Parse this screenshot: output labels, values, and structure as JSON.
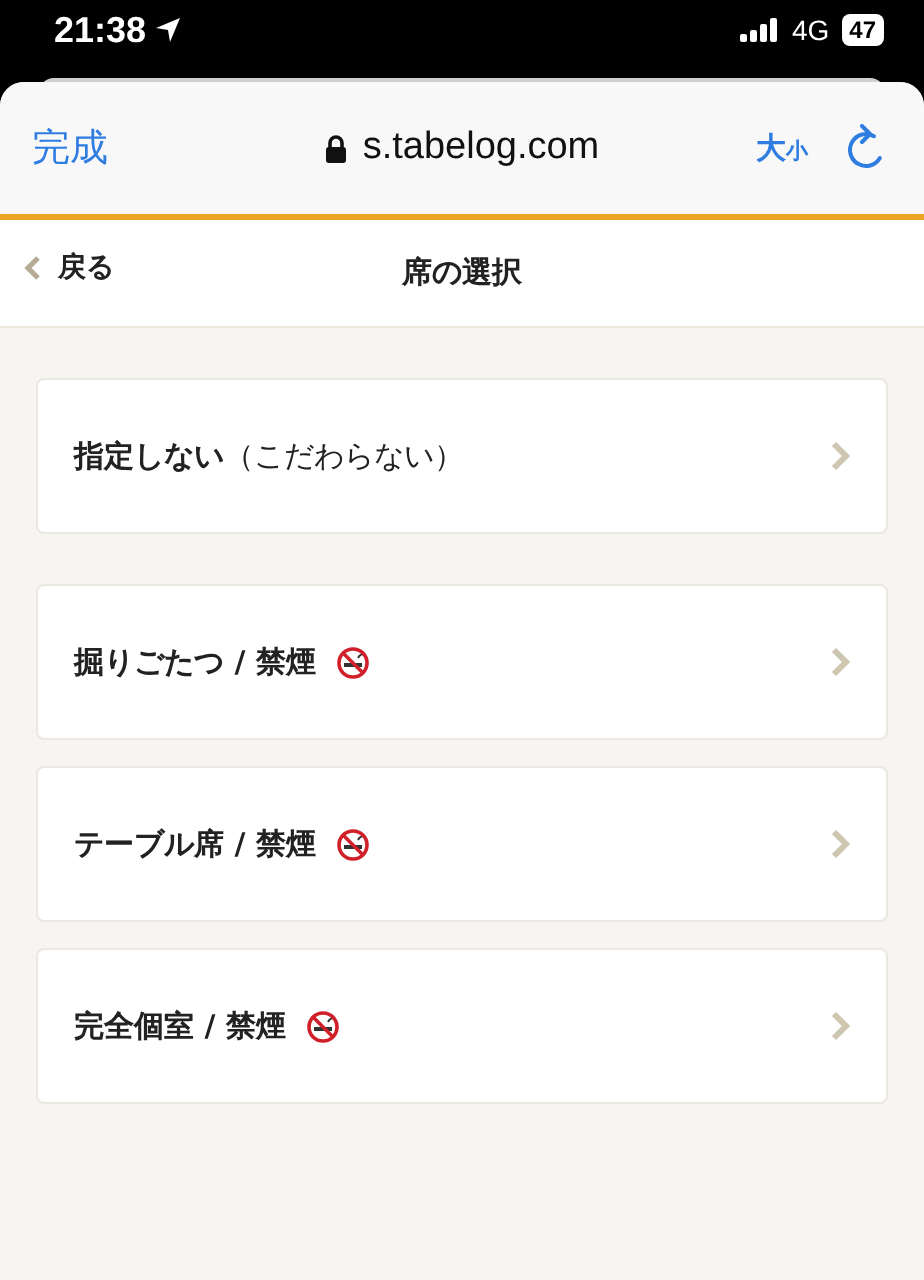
{
  "status_bar": {
    "time": "21:38",
    "network": "4G",
    "battery": "47"
  },
  "browser": {
    "done": "完成",
    "url": "s.tabelog.com",
    "text_size_big": "大",
    "text_size_small": "小"
  },
  "header": {
    "back": "戻る",
    "title": "席の選択"
  },
  "groups": [
    [
      {
        "label": "**指定しない**（こだわらない）",
        "no_smoking": false
      }
    ],
    [
      {
        "label": "掘りごたつ / 禁煙",
        "no_smoking": true
      },
      {
        "label": "テーブル席 / 禁煙",
        "no_smoking": true
      },
      {
        "label": "完全個室 / 禁煙",
        "no_smoking": true
      }
    ]
  ]
}
